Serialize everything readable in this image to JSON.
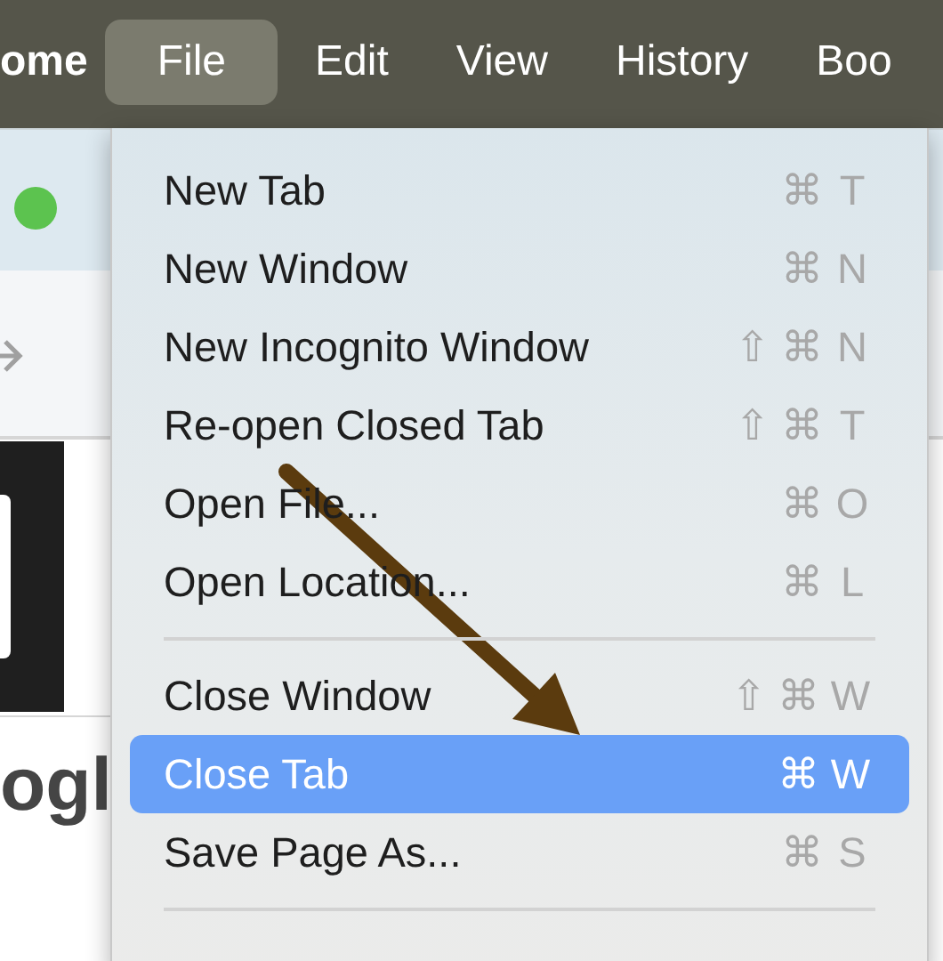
{
  "menu_bar": {
    "app_name": "ome",
    "items": [
      {
        "label": "File",
        "selected": true
      },
      {
        "label": "Edit",
        "selected": false
      },
      {
        "label": "View",
        "selected": false
      },
      {
        "label": "History",
        "selected": false
      },
      {
        "label": "Boo",
        "selected": false
      }
    ]
  },
  "browser_behind": {
    "heading_fragment": "ogl"
  },
  "file_menu": {
    "items": [
      {
        "kind": "item",
        "label": "New Tab",
        "shortcut": [
          "⌘",
          "T"
        ],
        "selected": false
      },
      {
        "kind": "item",
        "label": "New Window",
        "shortcut": [
          "⌘",
          "N"
        ],
        "selected": false
      },
      {
        "kind": "item",
        "label": "New Incognito Window",
        "shortcut": [
          "⇧",
          "⌘",
          "N"
        ],
        "selected": false
      },
      {
        "kind": "item",
        "label": "Re-open Closed Tab",
        "shortcut": [
          "⇧",
          "⌘",
          "T"
        ],
        "selected": false
      },
      {
        "kind": "item",
        "label": "Open File...",
        "shortcut": [
          "⌘",
          "O"
        ],
        "selected": false
      },
      {
        "kind": "item",
        "label": "Open Location...",
        "shortcut": [
          "⌘",
          "L"
        ],
        "selected": false
      },
      {
        "kind": "separator"
      },
      {
        "kind": "item",
        "label": "Close Window",
        "shortcut": [
          "⇧",
          "⌘",
          "W"
        ],
        "selected": false
      },
      {
        "kind": "item",
        "label": "Close Tab",
        "shortcut": [
          "⌘",
          "W"
        ],
        "selected": true
      },
      {
        "kind": "item",
        "label": "Save Page As...",
        "shortcut": [
          "⌘",
          "S"
        ],
        "selected": false
      },
      {
        "kind": "separator"
      }
    ]
  }
}
